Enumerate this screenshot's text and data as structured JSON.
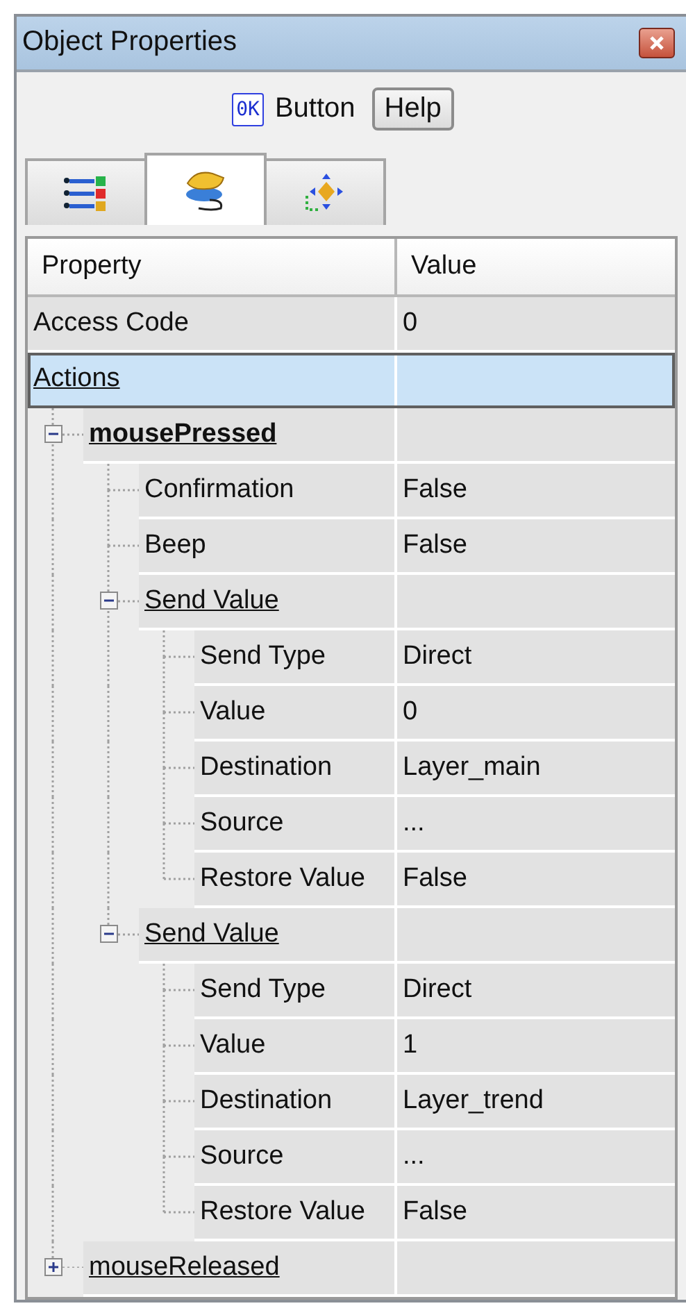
{
  "window": {
    "title": "Object Properties"
  },
  "toolbar": {
    "icon_text": "0K",
    "object_type": "Button",
    "help_button": "Help"
  },
  "tabs": [
    {
      "kind": "list",
      "selected": false
    },
    {
      "kind": "action",
      "selected": true
    },
    {
      "kind": "layout",
      "selected": false
    }
  ],
  "grid": {
    "columns": [
      "Property",
      "Value"
    ],
    "rows": [
      {
        "name": "Access Code",
        "value": "0",
        "kind": "property",
        "selected": false
      },
      {
        "name": "Actions",
        "kind": "group",
        "selected": true,
        "children": [
          {
            "name": "mousePressed",
            "kind": "group",
            "bold": true,
            "selected": false,
            "expanded": true,
            "children": [
              {
                "name": "Confirmation",
                "value": "False",
                "kind": "property",
                "selected": false
              },
              {
                "name": "Beep",
                "value": "False",
                "kind": "property",
                "selected": false
              },
              {
                "name": "Send Value",
                "kind": "group",
                "selected": false,
                "expanded": true,
                "children": [
                  {
                    "name": "Send Type",
                    "value": "Direct",
                    "kind": "property",
                    "selected": false
                  },
                  {
                    "name": "Value",
                    "value": "0",
                    "kind": "property",
                    "selected": false
                  },
                  {
                    "name": "Destination",
                    "value": "Layer_main",
                    "kind": "property",
                    "selected": false
                  },
                  {
                    "name": "Source",
                    "value": "...",
                    "kind": "property",
                    "selected": false
                  },
                  {
                    "name": "Restore Value",
                    "value": "False",
                    "kind": "property",
                    "selected": false
                  }
                ]
              },
              {
                "name": "Send Value",
                "kind": "group",
                "selected": false,
                "expanded": true,
                "children": [
                  {
                    "name": "Send Type",
                    "value": "Direct",
                    "kind": "property",
                    "selected": false
                  },
                  {
                    "name": "Value",
                    "value": "1",
                    "kind": "property",
                    "selected": false
                  },
                  {
                    "name": "Destination",
                    "value": "Layer_trend",
                    "kind": "property",
                    "selected": false
                  },
                  {
                    "name": "Source",
                    "value": "...",
                    "kind": "property",
                    "selected": false
                  },
                  {
                    "name": "Restore Value",
                    "value": "False",
                    "kind": "property",
                    "selected": false
                  }
                ]
              }
            ]
          },
          {
            "name": "mouseReleased",
            "kind": "group",
            "bold": false,
            "selected": false,
            "expanded": false
          }
        ]
      }
    ]
  }
}
